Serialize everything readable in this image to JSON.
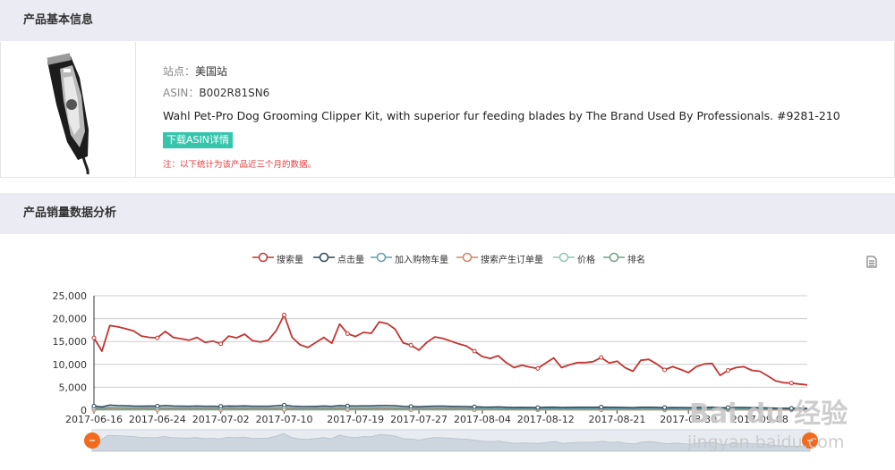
{
  "sections": {
    "basic_info_title": "产品基本信息",
    "sales_analysis_title": "产品销量数据分析"
  },
  "product": {
    "site_label": "站点：",
    "site_value": "美国站",
    "asin_label": "ASIN：",
    "asin_value": "B002R81SN6",
    "title": "Wahl Pet-Pro Dog Grooming Clipper Kit, with superior fur feeding blades by The Brand Used By Professionals. #9281-210",
    "download_button": "下载ASIN详情",
    "note": "注：以下统计为该产品近三个月的数据。",
    "image_icon": "hair-clipper-product-image"
  },
  "toolbox": {
    "icon": "data-view-icon"
  },
  "watermark": {
    "line1": "Bai du 经验",
    "line2": "jingyan.baidu.com"
  },
  "chart_data": {
    "type": "line",
    "title": "",
    "xlabel": "",
    "ylabel": "",
    "ylim": [
      0,
      25000
    ],
    "yticks": [
      "0",
      "5,000",
      "10,000",
      "15,000",
      "20,000",
      "25,000"
    ],
    "grid": true,
    "legend_position": "top-center",
    "x": [
      "2017-06-16",
      "2017-06-17",
      "2017-06-18",
      "2017-06-19",
      "2017-06-20",
      "2017-06-21",
      "2017-06-22",
      "2017-06-23",
      "2017-06-24",
      "2017-06-25",
      "2017-06-26",
      "2017-06-27",
      "2017-06-28",
      "2017-06-29",
      "2017-06-30",
      "2017-07-01",
      "2017-07-02",
      "2017-07-03",
      "2017-07-04",
      "2017-07-05",
      "2017-07-06",
      "2017-07-07",
      "2017-07-08",
      "2017-07-09",
      "2017-07-10",
      "2017-07-11",
      "2017-07-12",
      "2017-07-13",
      "2017-07-14",
      "2017-07-15",
      "2017-07-16",
      "2017-07-17",
      "2017-07-18",
      "2017-07-19",
      "2017-07-20",
      "2017-07-21",
      "2017-07-22",
      "2017-07-23",
      "2017-07-24",
      "2017-07-25",
      "2017-07-26",
      "2017-07-27",
      "2017-07-28",
      "2017-07-29",
      "2017-07-30",
      "2017-07-31",
      "2017-08-01",
      "2017-08-02",
      "2017-08-03",
      "2017-08-04",
      "2017-08-05",
      "2017-08-06",
      "2017-08-07",
      "2017-08-08",
      "2017-08-09",
      "2017-08-10",
      "2017-08-11",
      "2017-08-12",
      "2017-08-13",
      "2017-08-14",
      "2017-08-15",
      "2017-08-16",
      "2017-08-17",
      "2017-08-18",
      "2017-08-19",
      "2017-08-20",
      "2017-08-21",
      "2017-08-22",
      "2017-08-23",
      "2017-08-24",
      "2017-08-25",
      "2017-08-26",
      "2017-08-27",
      "2017-08-28",
      "2017-08-29",
      "2017-08-30",
      "2017-08-31",
      "2017-09-01",
      "2017-09-02",
      "2017-09-03",
      "2017-09-04",
      "2017-09-05",
      "2017-09-06",
      "2017-09-07",
      "2017-09-08",
      "2017-09-09",
      "2017-09-10",
      "2017-09-11",
      "2017-09-12",
      "2017-09-13",
      "2017-09-14"
    ],
    "x_tick_labels": [
      "2017-06-16",
      "2017-06-24",
      "2017-07-02",
      "2017-07-10",
      "2017-07-19",
      "2017-07-27",
      "2017-08-04",
      "2017-08-12",
      "2017-08-21",
      "2017-08-30",
      "2017-09-08"
    ],
    "series": [
      {
        "name": "搜索量",
        "color": "#c23531",
        "values": [
          15800,
          12900,
          18500,
          18200,
          17800,
          17300,
          16200,
          15900,
          15800,
          17200,
          15900,
          15600,
          15300,
          15900,
          14800,
          15100,
          14500,
          16200,
          15800,
          16600,
          15200,
          14900,
          15300,
          17400,
          20800,
          15900,
          14300,
          13700,
          14800,
          15900,
          14600,
          18800,
          16700,
          16100,
          17000,
          16800,
          19300,
          18900,
          17700,
          14700,
          14200,
          13100,
          14800,
          16000,
          15700,
          15100,
          14500,
          14000,
          12900,
          11700,
          11300,
          11900,
          10400,
          9300,
          9800,
          9400,
          9100,
          10300,
          11400,
          9300,
          9900,
          10400,
          10400,
          10600,
          11500,
          10300,
          10700,
          9300,
          8500,
          10900,
          11100,
          10100,
          8800,
          9500,
          8900,
          8200,
          9500,
          10100,
          10200,
          7600,
          8700,
          9300,
          9500,
          8700,
          8500,
          7500,
          6400,
          6000,
          5900,
          5700,
          5500
        ]
      },
      {
        "name": "点击量",
        "color": "#2f4554",
        "values": [
          900,
          700,
          1100,
          1000,
          950,
          900,
          880,
          900,
          880,
          1000,
          900,
          880,
          850,
          900,
          850,
          860,
          840,
          900,
          880,
          920,
          860,
          850,
          860,
          950,
          1100,
          880,
          820,
          800,
          840,
          900,
          830,
          1000,
          930,
          900,
          940,
          930,
          1000,
          990,
          950,
          820,
          800,
          760,
          840,
          880,
          870,
          840,
          810,
          790,
          740,
          690,
          670,
          700,
          630,
          580,
          600,
          580,
          570,
          620,
          660,
          580,
          600,
          620,
          620,
          630,
          670,
          620,
          640,
          580,
          540,
          640,
          650,
          610,
          550,
          580,
          560,
          530,
          580,
          610,
          620,
          500,
          550,
          580,
          590,
          550,
          540,
          490,
          430,
          410,
          400,
          390,
          380
        ]
      },
      {
        "name": "加入购物车量",
        "color": "#61a0a8",
        "values": [
          500,
          450,
          600,
          580,
          560,
          540,
          520,
          510,
          500,
          550,
          510,
          500,
          490,
          510,
          480,
          490,
          470,
          520,
          500,
          530,
          490,
          480,
          490,
          540,
          620,
          500,
          470,
          450,
          480,
          510,
          470,
          580,
          530,
          510,
          540,
          530,
          580,
          570,
          550,
          470,
          460,
          430,
          480,
          510,
          500,
          480,
          460,
          450,
          420,
          390,
          380,
          400,
          360,
          330,
          340,
          330,
          320,
          350,
          380,
          330,
          340,
          360,
          360,
          360,
          390,
          350,
          370,
          330,
          300,
          370,
          370,
          350,
          310,
          330,
          310,
          290,
          330,
          340,
          350,
          280,
          310,
          330,
          330,
          310,
          300,
          270,
          240,
          230,
          220,
          210,
          200
        ]
      },
      {
        "name": "搜索产生订单量",
        "color": "#d48265",
        "values": [
          150,
          120,
          180,
          170,
          165,
          160,
          155,
          150,
          150,
          160,
          150,
          148,
          145,
          150,
          140,
          142,
          138,
          150,
          148,
          155,
          145,
          142,
          145,
          160,
          180,
          148,
          138,
          132,
          140,
          150,
          138,
          170,
          155,
          150,
          158,
          156,
          170,
          168,
          162,
          140,
          136,
          128,
          140,
          148,
          146,
          140,
          135,
          130,
          120,
          112,
          108,
          112,
          100,
          92,
          95,
          92,
          90,
          98,
          105,
          92,
          96,
          100,
          100,
          101,
          108,
          99,
          102,
          92,
          86,
          104,
          105,
          98,
          88,
          93,
          88,
          84,
          92,
          97,
          98,
          78,
          87,
          92,
          93,
          87,
          85,
          77,
          68,
          64,
          63,
          61,
          59
        ]
      },
      {
        "name": "价格",
        "color": "#91c7ae",
        "values": [
          60,
          60,
          60,
          60,
          60,
          60,
          60,
          60,
          60,
          60,
          60,
          60,
          60,
          60,
          60,
          60,
          60,
          60,
          60,
          60,
          60,
          60,
          60,
          60,
          60,
          60,
          60,
          60,
          60,
          60,
          60,
          60,
          60,
          60,
          60,
          60,
          60,
          60,
          60,
          60,
          60,
          60,
          60,
          60,
          60,
          60,
          60,
          60,
          60,
          60,
          60,
          60,
          60,
          60,
          60,
          60,
          60,
          60,
          60,
          60,
          60,
          60,
          60,
          60,
          60,
          60,
          60,
          60,
          60,
          60,
          60,
          60,
          60,
          60,
          60,
          60,
          60,
          60,
          60,
          60,
          60,
          60,
          60,
          60,
          60,
          60,
          60,
          60,
          60,
          60,
          60
        ]
      },
      {
        "name": "排名",
        "color": "#749f83",
        "values": [
          300,
          310,
          290,
          295,
          300,
          305,
          310,
          312,
          315,
          305,
          310,
          315,
          318,
          312,
          320,
          318,
          322,
          315,
          318,
          312,
          320,
          322,
          320,
          310,
          295,
          318,
          325,
          328,
          322,
          315,
          322,
          305,
          312,
          315,
          310,
          312,
          300,
          302,
          308,
          322,
          325,
          330,
          322,
          316,
          318,
          322,
          326,
          328,
          334,
          340,
          342,
          338,
          346,
          352,
          350,
          352,
          354,
          348,
          344,
          352,
          350,
          348,
          348,
          346,
          342,
          348,
          346,
          352,
          358,
          346,
          344,
          348,
          356,
          352,
          355,
          360,
          354,
          350,
          350,
          362,
          356,
          352,
          350,
          355,
          356,
          362,
          370,
          372,
          374,
          376,
          378
        ]
      }
    ]
  }
}
